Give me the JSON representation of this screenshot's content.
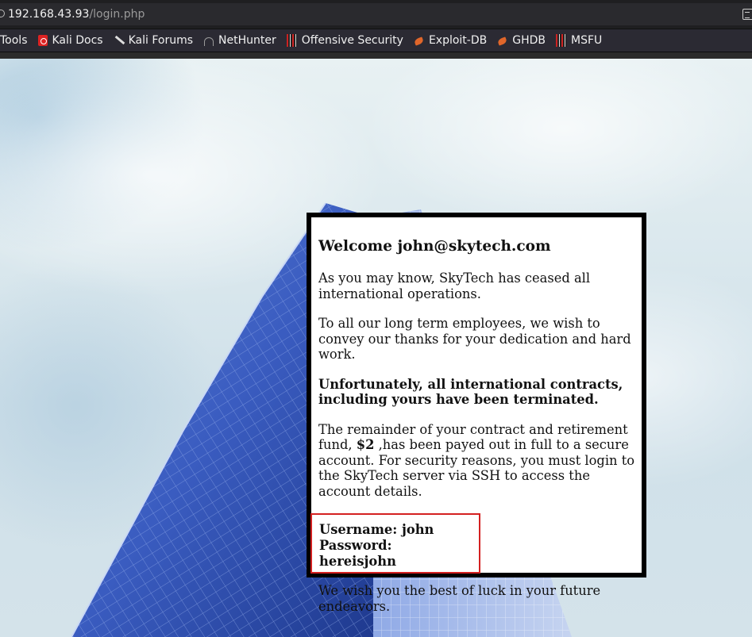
{
  "browser": {
    "url_host": "192.168.43.93",
    "url_path": "/login.php"
  },
  "bookmarks": [
    {
      "label": "Tools",
      "icon": "none"
    },
    {
      "label": "Kali Docs",
      "icon": "kali-docs-icon"
    },
    {
      "label": "Kali Forums",
      "icon": "kali-forums-icon"
    },
    {
      "label": "NetHunter",
      "icon": "nethunter-icon"
    },
    {
      "label": "Offensive Security",
      "icon": "offensive-security-icon"
    },
    {
      "label": "Exploit-DB",
      "icon": "exploit-db-icon"
    },
    {
      "label": "GHDB",
      "icon": "ghdb-icon"
    },
    {
      "label": "MSFU",
      "icon": "msfu-icon"
    }
  ],
  "message": {
    "heading": "Welcome john@skytech.com",
    "para1": "As you may know, SkyTech has ceased all international operations.",
    "para2": "To all our long term employees, we wish to convey our thanks for your dedication and hard work.",
    "para3_bold": "Unfortunately, all international contracts, including yours have been terminated.",
    "para4_pre": "The remainder of your contract and retirement fund, ",
    "para4_amount": "$2",
    "para4_post": " ,has been payed out in full to a secure account. For security reasons, you must login to the SkyTech server via SSH to access the account details.",
    "username_line": "Username: john",
    "password_line": "Password: hereisjohn",
    "closing": "We wish you the best of luck in your future endeavors."
  },
  "colors": {
    "highlight_border": "#d42020",
    "box_border": "#000000",
    "building_blue": "#3b5fc4"
  }
}
